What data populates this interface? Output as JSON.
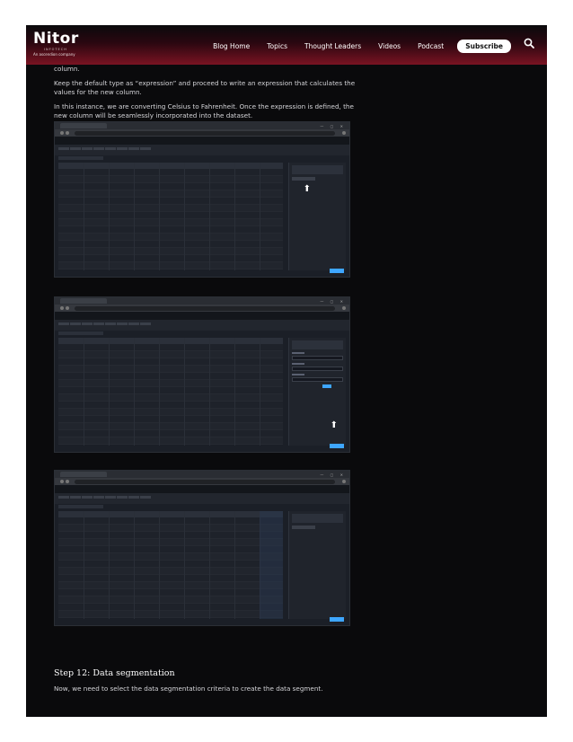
{
  "header": {
    "logo_main": "Nitor",
    "logo_sub1": "INFOTECH",
    "logo_sub2": "An ascendion company",
    "nav": [
      "Blog Home",
      "Topics",
      "Thought Leaders",
      "Videos",
      "Podcast"
    ],
    "subscribe_label": "Subscribe",
    "accent_color": "#7a1322"
  },
  "content": {
    "p0": "column.",
    "p1": "Keep the default type as “expression” and proceed to write an expression that calculates the values for the new column.",
    "p2": "In this instance, we are converting Celsius to Fahrenheit. Once the expression is defined, the new column will be seamlessly incorporated into the dataset."
  },
  "section": {
    "title": "Step 12: Data segmentation",
    "text": "Now, we need to select the data segmentation criteria to create the data segment."
  }
}
